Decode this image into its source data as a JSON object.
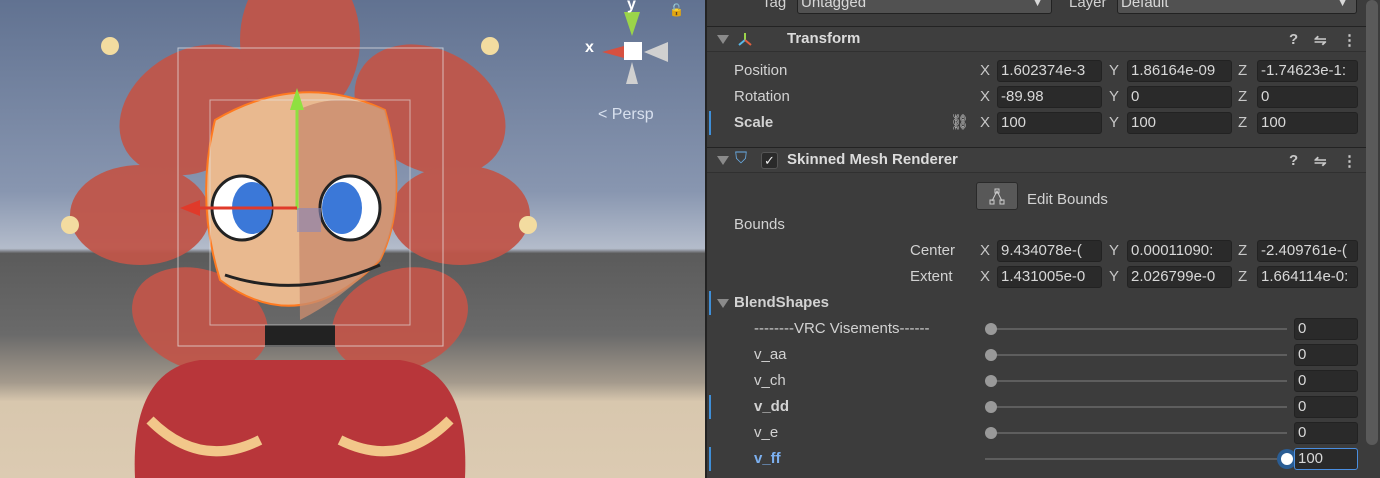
{
  "viewport": {
    "gizmo": {
      "y_label": "y",
      "x_label": "x",
      "projection": "Persp"
    }
  },
  "inspector": {
    "tag": {
      "label": "Tag",
      "value": "Untagged"
    },
    "layer": {
      "label": "Layer",
      "value": "Default"
    },
    "transform": {
      "title": "Transform",
      "position": {
        "label": "Position",
        "x": "1.602374e-3",
        "y": "1.86164e-09",
        "z": "-1.74623e-1:"
      },
      "rotation": {
        "label": "Rotation",
        "x": "-89.98",
        "y": "0",
        "z": "0"
      },
      "scale": {
        "label": "Scale",
        "x": "100",
        "y": "100",
        "z": "100"
      }
    },
    "smr": {
      "title": "Skinned Mesh Renderer",
      "enabled": true,
      "edit_bounds": "Edit Bounds",
      "bounds_label": "Bounds",
      "center": {
        "label": "Center",
        "x": "9.434078e-(",
        "y": "0.00011090:",
        "z": "-2.409761e-("
      },
      "extent": {
        "label": "Extent",
        "x": "1.431005e-0",
        "y": "2.026799e-0",
        "z": "1.664114e-0:"
      },
      "blendshapes_label": "BlendShapes",
      "blendshapes": [
        {
          "name": "--------VRC Visements------",
          "value": "0",
          "fraction": 0
        },
        {
          "name": "v_aa",
          "value": "0",
          "fraction": 0
        },
        {
          "name": "v_ch",
          "value": "0",
          "fraction": 0
        },
        {
          "name": "v_dd",
          "value": "0",
          "fraction": 0
        },
        {
          "name": "v_e",
          "value": "0",
          "fraction": 0
        },
        {
          "name": "v_ff",
          "value": "100",
          "fraction": 1
        }
      ]
    },
    "axes": {
      "x": "X",
      "y": "Y",
      "z": "Z"
    }
  }
}
